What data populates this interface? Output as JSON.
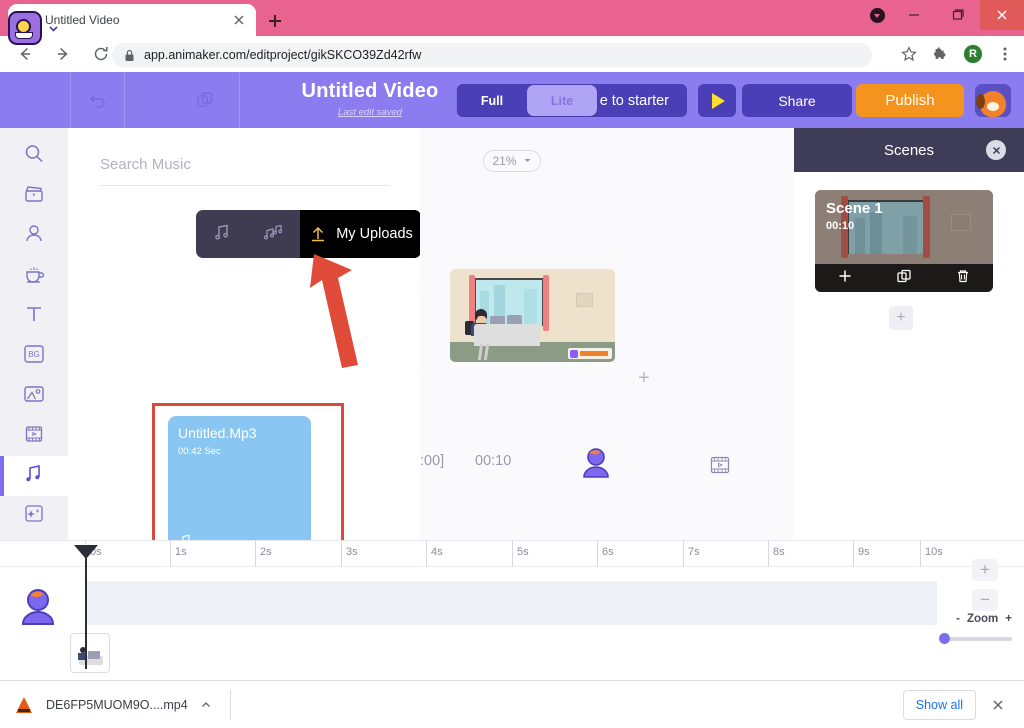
{
  "browser": {
    "tab": {
      "title": "Untitled Video",
      "favicon": "animaker-favicon",
      "close": "close-icon"
    },
    "newtab_label": "+",
    "window_controls": {
      "minimize": "−",
      "maximize": "□",
      "close": "×"
    },
    "toolbar": {
      "back": "back-arrow-icon",
      "forward": "forward-arrow-icon",
      "reload": "reload-icon",
      "lock": "lock-icon",
      "url": "app.animaker.com/editproject/gikSKCO39Zd42rfw",
      "bookmark": "star-icon",
      "extensions": "puzzle-icon",
      "profile_initial": "R",
      "menu": "three-dot-icon"
    }
  },
  "app_header": {
    "logo": "animaker-logo",
    "undo": "undo-icon",
    "copy": "duplicate-icon",
    "project_title": "Untitled Video",
    "project_status": "Last edit saved",
    "upgrade_label": "e to starter",
    "mode": {
      "full": "Full",
      "lite": "Lite",
      "active": "Full"
    },
    "play": "play-icon",
    "share_label": "Share",
    "publish_label": "Publish",
    "mascot": "dog-mascot-icon",
    "colors": {
      "header_bg": "#8b7df0",
      "button_bg": "#4b3fb7",
      "publish_bg": "#f5931f",
      "play_glyph": "#ffdd2e"
    }
  },
  "sidebar": {
    "items": [
      {
        "name": "search",
        "icon": "search-icon",
        "active": false
      },
      {
        "name": "video",
        "icon": "clapperboard-icon",
        "active": false
      },
      {
        "name": "character",
        "icon": "character-icon",
        "active": false
      },
      {
        "name": "props",
        "icon": "cup-icon",
        "active": false
      },
      {
        "name": "text",
        "icon": "text-icon",
        "active": false
      },
      {
        "name": "background",
        "icon": "bg-icon",
        "label": "BG",
        "active": false
      },
      {
        "name": "image",
        "icon": "image-icon",
        "active": false
      },
      {
        "name": "video-clip",
        "icon": "filmstrip-icon",
        "active": false
      },
      {
        "name": "music",
        "icon": "music-note-icon",
        "active": true
      },
      {
        "name": "effects",
        "icon": "sparkle-icon",
        "active": false
      }
    ]
  },
  "music_panel": {
    "search_placeholder": "Search Music",
    "search_value": "",
    "tabs": [
      {
        "name": "music",
        "icon": "music-note-icon",
        "active": false
      },
      {
        "name": "sound-effects",
        "icon": "sound-effects-icon",
        "active": false
      },
      {
        "name": "my-uploads",
        "label": "My Uploads",
        "icon": "upload-icon",
        "active": true
      }
    ],
    "uploads": [
      {
        "title": "Untitled.Mp3",
        "duration": "00:42 Sec",
        "icon": "music-note-icon"
      }
    ],
    "collapse": "chevron-left-icon",
    "highlight_color": "#d94a3d"
  },
  "canvas": {
    "zoom_value": "21%",
    "zoom_caret": "chevron-down-icon",
    "add_marker": "+",
    "time_start": ":00]",
    "time_end": "00:10",
    "character_icon": "character-icon",
    "film_icon": "filmstrip-icon"
  },
  "scenes_panel": {
    "title": "Scenes",
    "close": "close-icon",
    "scenes": [
      {
        "label": "Scene 1",
        "duration": "00:10",
        "actions": [
          {
            "name": "add-scene",
            "icon": "plus-icon"
          },
          {
            "name": "duplicate-scene",
            "icon": "duplicate-icon"
          },
          {
            "name": "delete-scene",
            "icon": "trash-icon"
          }
        ]
      }
    ],
    "add_scene_label": "+"
  },
  "timeline": {
    "ticks": [
      "0s",
      "1s",
      "2s",
      "3s",
      "4s",
      "5s",
      "6s",
      "7s",
      "8s",
      "9s",
      "10s"
    ],
    "playhead_time": "0s",
    "track_icon": "character-icon",
    "scene_strip": "scene-thumbnail",
    "zoom_in_label": "+",
    "zoom_out_label": "−",
    "zoom_minus": "-",
    "zoom_label": "Zoom",
    "zoom_plus": "+"
  },
  "download_bar": {
    "file_icon": "vlc-icon",
    "filename": "DE6FP5MUOM9O....mp4",
    "expand": "chevron-up-icon",
    "show_all_label": "Show all",
    "close": "close-icon"
  }
}
